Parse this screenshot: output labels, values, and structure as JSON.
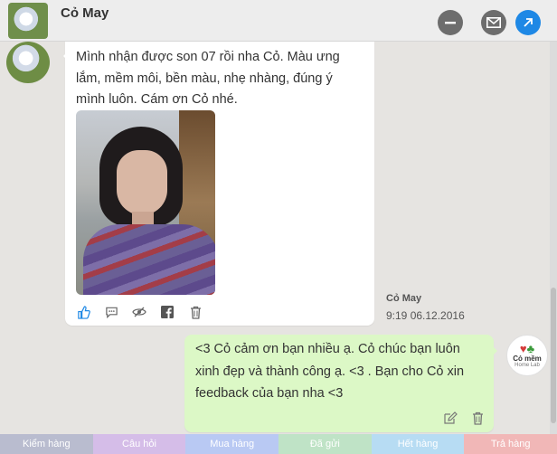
{
  "header": {
    "title": "Cỏ May"
  },
  "incoming": {
    "text": "Mình nhận được son 07 rồi nha Cỏ. Màu ưng lắm, mềm môi, bền màu, nhẹ nhàng, đúng ý mình luôn. Cám ơn Cỏ nhé."
  },
  "meta": {
    "sender": "Cỏ May",
    "time": "9:19 06.12.2016"
  },
  "outgoing": {
    "text": "<3 Cỏ cảm ơn bạn nhiều ạ. Cỏ chúc bạn luôn xinh đẹp và thành công ạ. <3 . Bạn cho Cỏ xin feedback của bạn nha <3"
  },
  "brand": {
    "name": "Cỏ mềm",
    "sub": "Home Lab"
  },
  "tabs": [
    {
      "label": "Kiểm hàng",
      "color": "#b9bccf"
    },
    {
      "label": "Câu hỏi",
      "color": "#d5bde8"
    },
    {
      "label": "Mua hàng",
      "color": "#b9c9f3"
    },
    {
      "label": "Đã gửi",
      "color": "#bfe3c6"
    },
    {
      "label": "Hết hàng",
      "color": "#b7dcf3"
    },
    {
      "label": "Trả hàng",
      "color": "#f1b7b7"
    }
  ],
  "icons": {
    "minus": "minus-circle-icon",
    "mail": "mail-icon",
    "open": "open-external-icon",
    "like": "thumbs-up-icon",
    "comment": "comment-icon",
    "hide": "eye-slash-icon",
    "facebook": "facebook-icon",
    "delete": "trash-icon",
    "edit": "edit-icon"
  },
  "colors": {
    "accent": "#1e88e5",
    "outgoing_bubble": "#dcf8c6"
  }
}
